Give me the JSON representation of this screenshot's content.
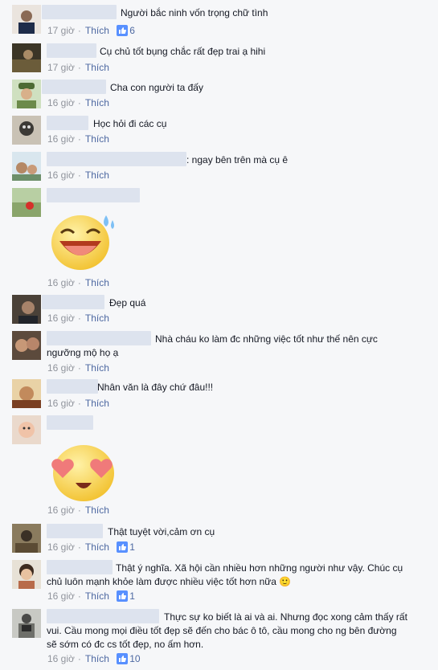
{
  "like_label": "Thích",
  "comments": [
    {
      "text": "Người bắc ninh vốn trọng chữ tình",
      "time": "17 giờ",
      "likes": "6"
    },
    {
      "text": "Cụ chủ tốt bụng chắc rất đẹp trai ạ hihi",
      "time": "17 giờ",
      "likes": ""
    },
    {
      "text": "Cha con người ta đấy",
      "time": "16 giờ",
      "likes": ""
    },
    {
      "text": "Học hỏi đi các cụ",
      "time": "16 giờ",
      "likes": ""
    },
    {
      "text": ": ngay bên trên mà cụ ê",
      "time": "16 giờ",
      "likes": ""
    },
    {
      "text": "",
      "time": "16 giờ",
      "likes": "",
      "sticker": "laughing-face"
    },
    {
      "text": "Đẹp quá",
      "time": "16 giờ",
      "likes": ""
    },
    {
      "text": "Nhà cháu ko làm đc những việc tốt như thế nên cực ngưỡng mộ họ ạ",
      "time": "16 giờ",
      "likes": ""
    },
    {
      "text": "Nhân văn là đây chứ đâu!!!",
      "time": "16 giờ",
      "likes": ""
    },
    {
      "text": "",
      "time": "16 giờ",
      "likes": "",
      "sticker": "heart-eyes-face"
    },
    {
      "text": "Thật tuyệt vời,cảm ơn cụ",
      "time": "16 giờ",
      "likes": "1"
    },
    {
      "text": "Thật ý nghĩa. Xã hội cần nhiều hơn những người như vậy. Chúc cụ chủ luôn mạnh khỏe làm được nhiều việc tốt hơn nữa 🙂",
      "time": "16 giờ",
      "likes": "1"
    },
    {
      "text": "Thực sự ko biết là ai và ai. Nhưng đọc xong cảm thấy rất vui. Cầu mong mọi điều tốt đẹp sẽ đến cho bác ô tô, cầu mong cho ng bên đường sẽ sớm có đc cs tốt đẹp, no ấm hơn.",
      "time": "16 giờ",
      "likes": "10"
    }
  ],
  "colors": {
    "like_blue": "#4e69a2",
    "meta_gray": "#90949c",
    "background": "#f6f7f9"
  }
}
